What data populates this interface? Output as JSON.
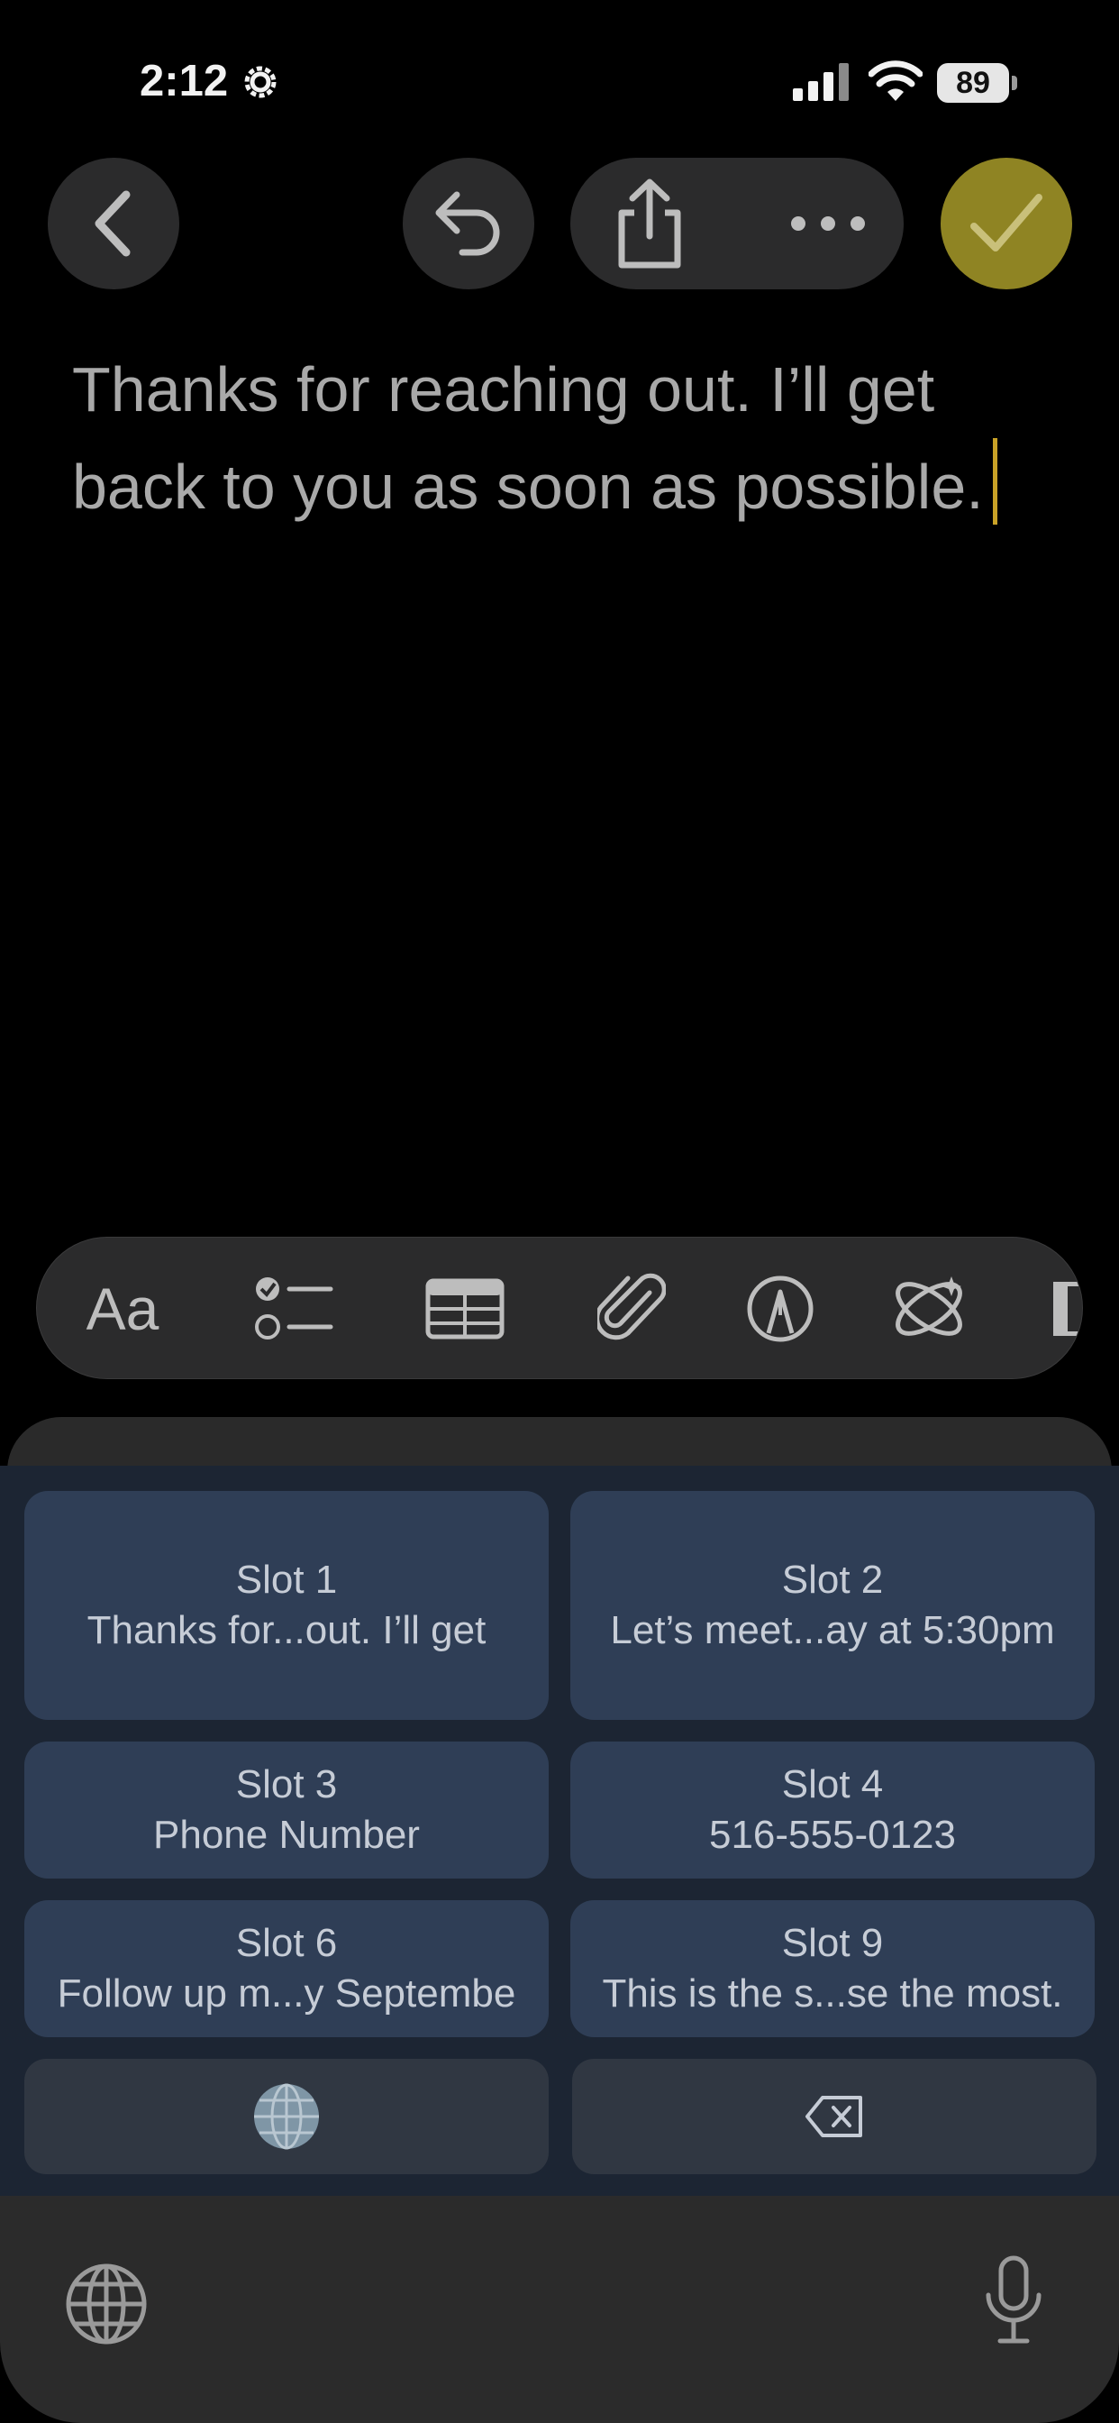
{
  "status_bar": {
    "time": "2:12",
    "battery_level": "89",
    "icons": [
      "gear-icon",
      "signal-icon",
      "wifi-icon",
      "battery-icon"
    ]
  },
  "toolbar": {
    "icons": [
      "chevron-left-icon",
      "undo-icon",
      "share-icon",
      "more-icon",
      "checkmark-icon"
    ],
    "done_color": "#8f8423"
  },
  "note": {
    "line1": "Thanks for reaching out.  I’ll get",
    "line2": "back to you as soon as possible."
  },
  "format_bar": {
    "text_style_label": "Aa",
    "icons": [
      "checklist-icon",
      "table-icon",
      "paperclip-icon",
      "markup-pen-icon",
      "writing-tools-icon"
    ]
  },
  "keyboard": {
    "slots": [
      {
        "title": "Slot 1",
        "preview": "Thanks for...out.  I’ll get"
      },
      {
        "title": "Slot 2",
        "preview": "Let’s meet...ay at 5:30pm"
      },
      {
        "title": "Slot 3",
        "preview": "Phone Number"
      },
      {
        "title": "Slot 4",
        "preview": "516-555-0123"
      },
      {
        "title": "Slot 6",
        "preview": "Follow up m...y Septembe"
      },
      {
        "title": "Slot 9",
        "preview": "This is the s...se the most."
      }
    ],
    "panel_color": "#1c2533",
    "slot_color": "#2f3e56",
    "icons": [
      "globe-icon",
      "delete-backward-icon",
      "microphone-icon"
    ]
  }
}
